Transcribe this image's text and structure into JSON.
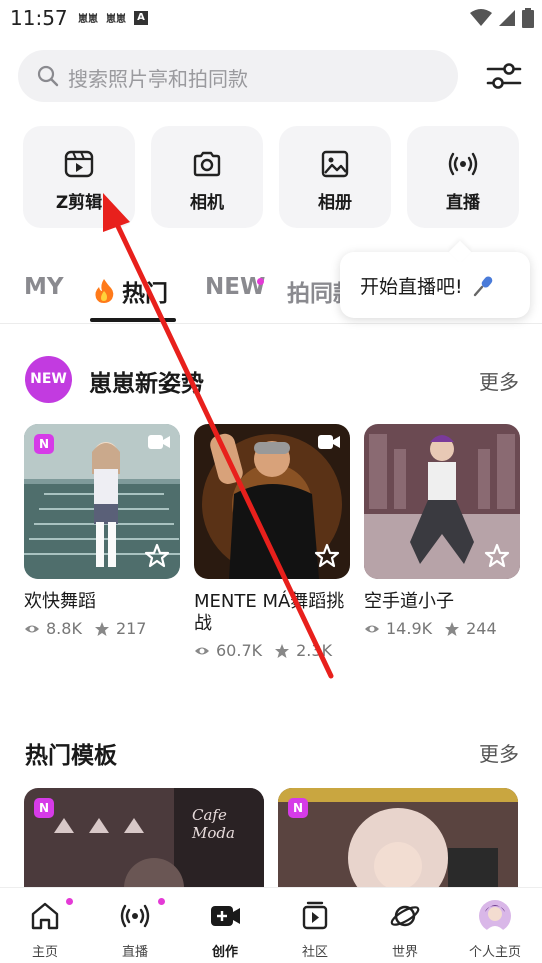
{
  "status_bar": {
    "time": "11:57",
    "app_badges": [
      "崽崽",
      "崽崽"
    ],
    "letter_badge": "A"
  },
  "search": {
    "placeholder": "搜索照片亭和拍同款"
  },
  "tools": [
    {
      "label": "Z剪辑",
      "icon": "video-edit-icon"
    },
    {
      "label": "相机",
      "icon": "camera-icon"
    },
    {
      "label": "相册",
      "icon": "image-icon"
    },
    {
      "label": "直播",
      "icon": "broadcast-icon"
    }
  ],
  "tabs": {
    "my": "MY",
    "hot": "热门",
    "new": "NEW",
    "same": "拍同款"
  },
  "tooltip": {
    "text": "开始直播吧!"
  },
  "section_new": {
    "badge": "NEW",
    "title": "崽崽新姿势",
    "more": "更多"
  },
  "cards": [
    {
      "title": "欢快舞蹈",
      "views": "8.8K",
      "stars": "217"
    },
    {
      "title": "MENTE MÁ舞蹈挑战",
      "views": "60.7K",
      "stars": "2.3K"
    },
    {
      "title": "空手道小子",
      "views": "14.9K",
      "stars": "244"
    }
  ],
  "section_templates": {
    "title": "热门模板",
    "more": "更多",
    "badge_letter": "N",
    "tpl1_text": "Cafe Moda"
  },
  "nav": [
    {
      "label": "主页",
      "icon": "home-icon"
    },
    {
      "label": "直播",
      "icon": "live-icon"
    },
    {
      "label": "创作",
      "icon": "create-icon"
    },
    {
      "label": "社区",
      "icon": "community-icon"
    },
    {
      "label": "世界",
      "icon": "planet-icon"
    },
    {
      "label": "个人主页",
      "icon": "avatar-icon"
    }
  ],
  "colors": {
    "accent": "#e43ad6",
    "badge_purple": "#c23be0",
    "annotation_red": "#e8201c"
  }
}
